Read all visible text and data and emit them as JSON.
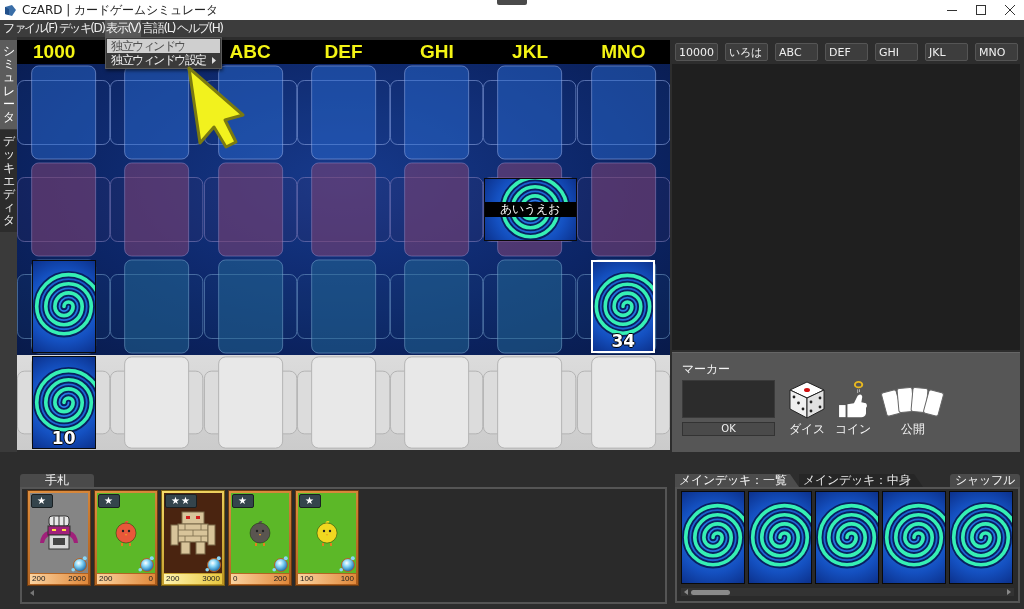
{
  "window": {
    "title": "CzARD | カードゲームシミュレータ"
  },
  "menu": [
    {
      "label": "ファイル(F)",
      "selected": false
    },
    {
      "label": "デッキ(D)",
      "selected": false
    },
    {
      "label": "表示(V)",
      "selected": true
    },
    {
      "label": "言語(L)",
      "selected": false
    },
    {
      "label": "ヘルプ(H)",
      "selected": false
    }
  ],
  "dropdown": [
    {
      "label": "独立ウィンドウ",
      "highlighted": true,
      "submenu": false
    },
    {
      "label": "独立ウィンドウ設定",
      "highlighted": false,
      "submenu": true
    }
  ],
  "sidebar_tabs": [
    {
      "label": "シミュレータ",
      "selected": true
    },
    {
      "label": "デッキエディタ",
      "selected": false
    }
  ],
  "board": {
    "zones": [
      {
        "kind": "blue"
      },
      {
        "kind": "purple"
      },
      {
        "kind": "teal"
      },
      {
        "kind": "light"
      }
    ],
    "columns": [
      {
        "header": "1000",
        "cells": [
          null,
          null,
          {
            "kind": "upright",
            "selected": false
          },
          {
            "kind": "upright",
            "count": "10",
            "selected": false
          }
        ]
      },
      {
        "cells": [
          null,
          null,
          null,
          null
        ]
      },
      {
        "header": "ABC",
        "cells": [
          null,
          null,
          null,
          null
        ]
      },
      {
        "header": "DEF",
        "cells": [
          null,
          null,
          null,
          null
        ]
      },
      {
        "header": "GHI",
        "cells": [
          null,
          null,
          null,
          null
        ]
      },
      {
        "header": "JKL",
        "cells": [
          null,
          {
            "kind": "sideways",
            "label": "あいうえお",
            "selected": false
          },
          null,
          null
        ]
      },
      {
        "header": "MNO",
        "cells": [
          null,
          null,
          {
            "kind": "upright",
            "count": "34",
            "selected": true
          },
          null
        ]
      }
    ]
  },
  "column_buttons": [
    "10000",
    "いろは",
    "ABC",
    "DEF",
    "GHI",
    "JKL",
    "MNO"
  ],
  "marker": {
    "label": "マーカー",
    "ok_button": "OK"
  },
  "tools": [
    {
      "kind": "dice",
      "label": "ダイス"
    },
    {
      "kind": "coin",
      "label": "コイン"
    },
    {
      "kind": "reveal",
      "label": "公開"
    }
  ],
  "hand": {
    "tab": "手札",
    "cards": [
      {
        "badge": "★",
        "kind": "bronze",
        "color": "#858585",
        "creature": {
          "kind": "chest",
          "color": "#a0207a"
        },
        "values": [
          "200",
          "2000"
        ]
      },
      {
        "badge": "★",
        "kind": "bronze",
        "color": "#5cb828",
        "creature": {
          "kind": "chick",
          "color": "#e8583a"
        },
        "values": [
          "200",
          "0"
        ]
      },
      {
        "badge": "★★",
        "kind": "gold",
        "color": "#4a2410",
        "creature": {
          "kind": "golem",
          "color": "#d8c49a"
        },
        "values": [
          "200",
          "3000"
        ]
      },
      {
        "badge": "★",
        "kind": "bronze",
        "color": "#5cb828",
        "creature": {
          "kind": "chick",
          "color": "#5a5550"
        },
        "values": [
          "0",
          "200"
        ]
      },
      {
        "badge": "★",
        "kind": "bronze",
        "color": "#5cb828",
        "creature": {
          "kind": "chick",
          "color": "#f0d820"
        },
        "values": [
          "100",
          "100"
        ]
      }
    ]
  },
  "deck": {
    "tabs": [
      {
        "label": "メインデッキ：一覧",
        "selected": true
      },
      {
        "label": "メインデッキ：中身",
        "selected": false
      }
    ],
    "shuffle_button": "シャッフル",
    "cards": [
      {
        "kind": "back"
      },
      {
        "kind": "back"
      },
      {
        "kind": "back"
      },
      {
        "kind": "back"
      },
      {
        "kind": "back"
      }
    ]
  }
}
